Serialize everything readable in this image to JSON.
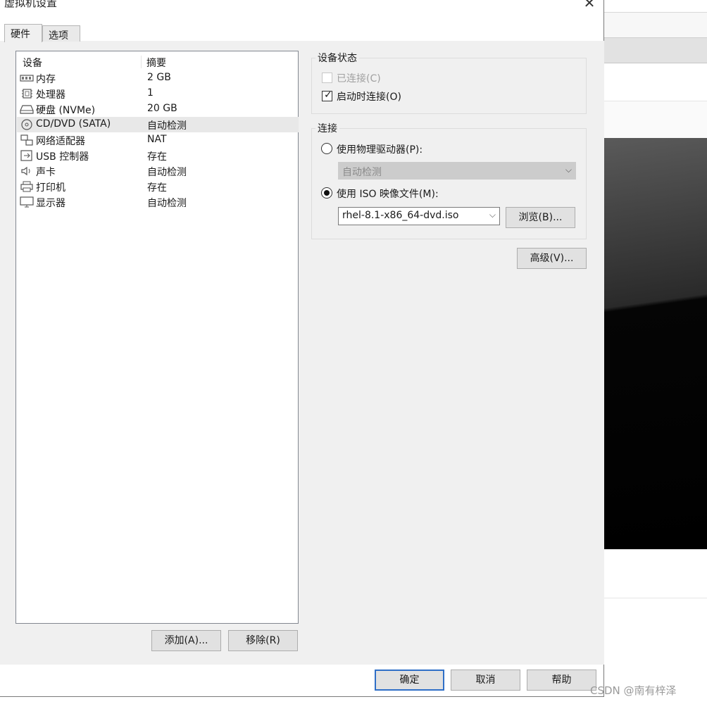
{
  "window": {
    "title": "虚拟机设置",
    "close": "✕"
  },
  "tabs": [
    {
      "label": "硬件"
    },
    {
      "label": "选项"
    }
  ],
  "device_list": {
    "headers": {
      "device": "设备",
      "summary": "摘要"
    },
    "rows": [
      {
        "name": "内存",
        "summary": "2 GB",
        "icon": "memory-icon"
      },
      {
        "name": "处理器",
        "summary": "1",
        "icon": "processor-icon"
      },
      {
        "name": "硬盘 (NVMe)",
        "summary": "20 GB",
        "icon": "harddisk-icon"
      },
      {
        "name": "CD/DVD (SATA)",
        "summary": "自动检测",
        "icon": "cd-dvd-icon",
        "selected": true
      },
      {
        "name": "网络适配器",
        "summary": "NAT",
        "icon": "network-adapter-icon"
      },
      {
        "name": "USB 控制器",
        "summary": "存在",
        "icon": "usb-icon"
      },
      {
        "name": "声卡",
        "summary": "自动检测",
        "icon": "speaker-icon"
      },
      {
        "name": "打印机",
        "summary": "存在",
        "icon": "printer-icon"
      },
      {
        "name": "显示器",
        "summary": "自动检测",
        "icon": "monitor-icon"
      }
    ]
  },
  "buttons": {
    "add": "添加(A)...",
    "remove": "移除(R)",
    "browse": "浏览(B)...",
    "advanced": "高级(V)...",
    "ok": "确定",
    "cancel": "取消",
    "help": "帮助"
  },
  "device_status": {
    "title": "设备状态",
    "connected": {
      "label": "已连接(C)",
      "checked": false,
      "disabled": true
    },
    "connect_at_power_on": {
      "label": "启动时连接(O)",
      "checked": true
    }
  },
  "connection": {
    "title": "连接",
    "physical": {
      "label": "使用物理驱动器(P):",
      "selected": false,
      "dropdown_value": "自动检测"
    },
    "iso": {
      "label": "使用 ISO 映像文件(M):",
      "selected": true,
      "value": "rhel-8.1-x86_64-dvd.iso"
    }
  },
  "watermark": "CSDN @南有梓泽"
}
